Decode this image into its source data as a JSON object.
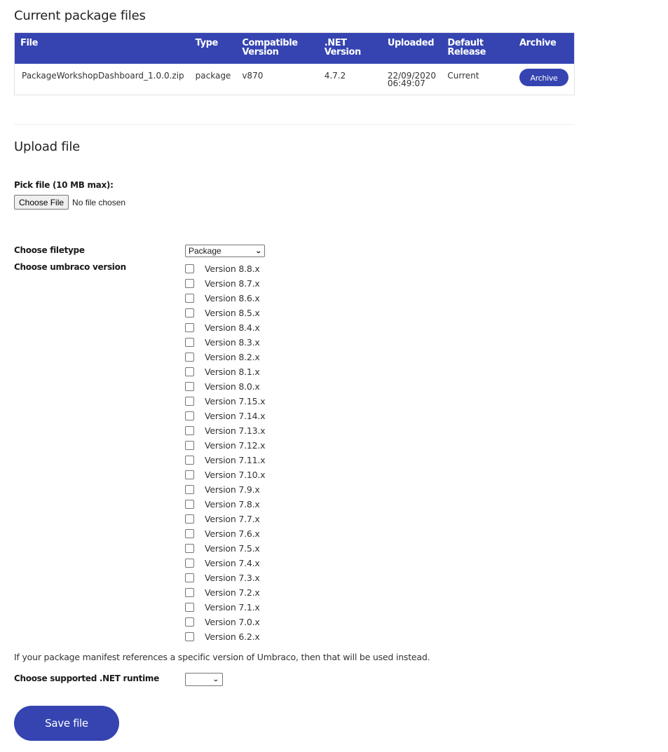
{
  "current_files": {
    "title": "Current package files",
    "columns": [
      "File",
      "Type",
      "Compatible Version",
      ".NET Version",
      "Uploaded",
      "Default Release",
      "Archive"
    ],
    "rows": [
      {
        "file": "PackageWorkshopDashboard_1.0.0.zip",
        "type": "package",
        "compatible_version": "v870",
        "net_version": "4.7.2",
        "uploaded_date": "22/09/2020",
        "uploaded_time": "06:49:07",
        "default_release": "Current",
        "archive_label": "Archive"
      }
    ]
  },
  "upload": {
    "title": "Upload file",
    "pick_file_label": "Pick file (10 MB max):",
    "choose_file_button": "Choose File",
    "no_file_text": "No file chosen",
    "filetype_label": "Choose filetype",
    "filetype_selected": "Package",
    "umbraco_version_label": "Choose umbraco version",
    "versions": [
      {
        "label": "Version 8.8.x",
        "checked": false
      },
      {
        "label": "Version 8.7.x",
        "checked": false
      },
      {
        "label": "Version 8.6.x",
        "checked": false
      },
      {
        "label": "Version 8.5.x",
        "checked": false
      },
      {
        "label": "Version 8.4.x",
        "checked": false
      },
      {
        "label": "Version 8.3.x",
        "checked": false
      },
      {
        "label": "Version 8.2.x",
        "checked": false
      },
      {
        "label": "Version 8.1.x",
        "checked": false
      },
      {
        "label": "Version 8.0.x",
        "checked": false
      },
      {
        "label": "Version 7.15.x",
        "checked": false
      },
      {
        "label": "Version 7.14.x",
        "checked": false
      },
      {
        "label": "Version 7.13.x",
        "checked": false
      },
      {
        "label": "Version 7.12.x",
        "checked": false
      },
      {
        "label": "Version 7.11.x",
        "checked": false
      },
      {
        "label": "Version 7.10.x",
        "checked": false
      },
      {
        "label": "Version 7.9.x",
        "checked": false
      },
      {
        "label": "Version 7.8.x",
        "checked": false
      },
      {
        "label": "Version 7.7.x",
        "checked": false
      },
      {
        "label": "Version 7.6.x",
        "checked": false
      },
      {
        "label": "Version 7.5.x",
        "checked": false
      },
      {
        "label": "Version 7.4.x",
        "checked": false
      },
      {
        "label": "Version 7.3.x",
        "checked": false
      },
      {
        "label": "Version 7.2.x",
        "checked": false
      },
      {
        "label": "Version 7.1.x",
        "checked": false
      },
      {
        "label": "Version 7.0.x",
        "checked": false
      },
      {
        "label": "Version 6.2.x",
        "checked": false
      }
    ],
    "manifest_note": "If your package manifest references a specific version of Umbraco, then that will be used instead.",
    "net_runtime_label": "Choose supported .NET runtime",
    "net_runtime_selected": "",
    "save_button": "Save file"
  },
  "colors": {
    "accent": "#3544b1"
  }
}
